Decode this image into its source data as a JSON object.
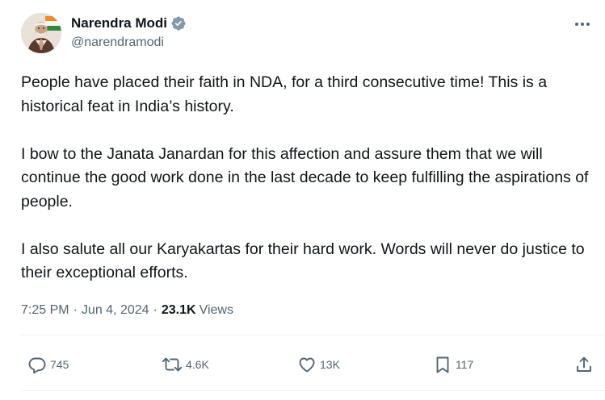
{
  "author": {
    "display_name": "Narendra Modi",
    "handle": "@narendramodi",
    "verified_icon": "verified-badge-icon",
    "avatar_alt": "avatar"
  },
  "tweet": {
    "paragraphs": [
      "People have placed their faith in NDA, for a third consecutive time! This is a historical feat in India’s history.",
      "I bow to the Janata Janardan for this affection and assure them that we will continue the good work done in the last decade to keep fulfilling the aspirations of people.",
      "I also salute all our Karyakartas for their hard work. Words will never do justice to their exceptional efforts."
    ]
  },
  "meta": {
    "time": "7:25 PM",
    "separator": "·",
    "date": "Jun 4, 2024",
    "views_count": "23.1K",
    "views_label": "Views"
  },
  "actions": {
    "reply_count": "745",
    "retweet_count": "4.6K",
    "like_count": "13K",
    "bookmark_count": "117"
  },
  "colors": {
    "text_primary": "#0f1419",
    "text_secondary": "#536471",
    "verified_blue": "#829aab",
    "divider": "#eff3f4"
  },
  "icons": [
    "more-icon",
    "reply-icon",
    "retweet-icon",
    "like-icon",
    "bookmark-icon",
    "share-icon"
  ]
}
